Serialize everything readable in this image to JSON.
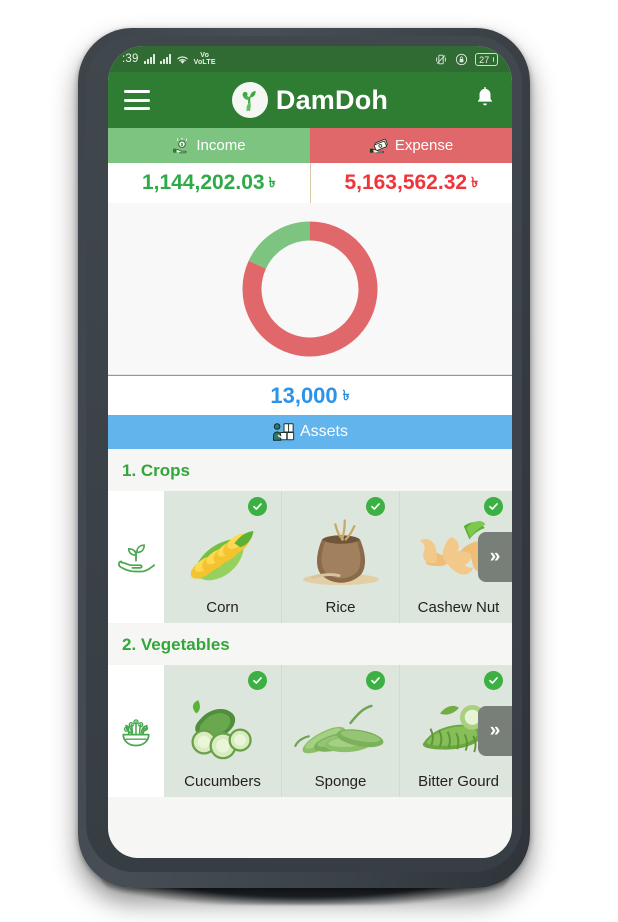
{
  "statusbar": {
    "time": ":39",
    "network_label": "VoLTE",
    "battery_level": "27",
    "icons": [
      "signal-bars-icon",
      "signal-bars-icon",
      "wifi-icon",
      "volte-icon",
      "vibrate-icon",
      "screen-lock-icon",
      "battery-icon"
    ]
  },
  "appbar": {
    "menu_icon": "hamburger-menu-icon",
    "logo_icon": "damdoh-plant-logo-icon",
    "title": "DamDoh",
    "notification_icon": "bell-icon"
  },
  "summary": {
    "income_label": "Income",
    "income_value": "1,144,202.03",
    "expense_label": "Expense",
    "expense_value": "5,163,562.32",
    "currency": "৳",
    "balance_value": "13,000",
    "assets_label": "Assets",
    "assets_icon": "assets-boxes-person-icon",
    "income_icon": "hand-coin-icon",
    "expense_icon": "hand-cash-icon"
  },
  "chart_data": {
    "type": "pie",
    "title": "",
    "categories": [
      "Income",
      "Expense"
    ],
    "values": [
      1144202.03,
      5163562.32
    ],
    "percentages": [
      18.1,
      81.9
    ],
    "colors": [
      "#7cc47f",
      "#e0686b"
    ],
    "donut": true,
    "inner_radius_ratio": 0.66,
    "legend": "none",
    "start_angle_deg": 0,
    "direction": "counterclockwise"
  },
  "categories": [
    {
      "title": "1. Crops",
      "icon": "hand-sprout-icon",
      "next_icon": "chevron-double-right-icon",
      "items": [
        {
          "label": "Corn",
          "thumb": "corn-image",
          "selected": true
        },
        {
          "label": "Rice",
          "thumb": "rice-sack-image",
          "selected": true
        },
        {
          "label": "Cashew Nut",
          "thumb": "cashew-nut-image",
          "selected": true
        }
      ]
    },
    {
      "title": "2. Vegetables",
      "icon": "salad-bowl-icon",
      "next_icon": "chevron-double-right-icon",
      "items": [
        {
          "label": "Cucumbers",
          "thumb": "cucumber-image",
          "selected": true
        },
        {
          "label": "Sponge",
          "thumb": "sponge-gourd-image",
          "selected": true
        },
        {
          "label": "Bitter Gourd",
          "thumb": "bitter-gourd-image",
          "selected": true
        }
      ]
    }
  ],
  "colors": {
    "brand_green": "#2f7d32",
    "income_green": "#7cc47f",
    "expense_red": "#e0686b",
    "accent_blue": "#62b4ec",
    "section_green": "#33a63a"
  }
}
